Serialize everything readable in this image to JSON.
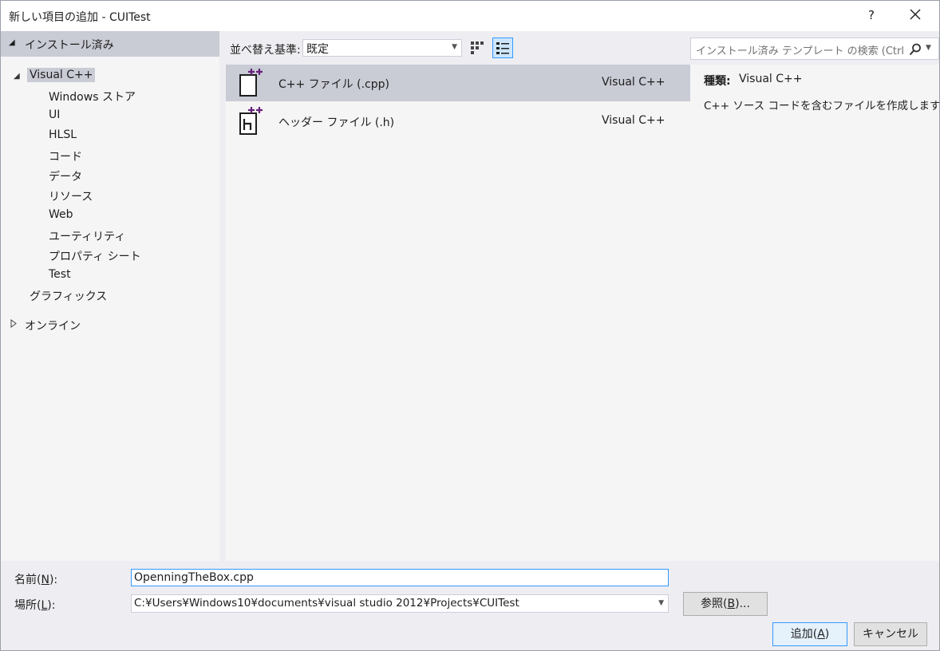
{
  "window": {
    "title": "新しい項目の追加 - CUITest",
    "help_glyph": "?",
    "close_icon": "close-icon"
  },
  "tree": {
    "installed_label": "インストール済み",
    "visual_cpp": "Visual C++",
    "children": [
      "Windows ストア",
      "UI",
      "HLSL",
      "コード",
      "データ",
      "リソース",
      "Web",
      "ユーティリティ",
      "プロパティ シート",
      "Test"
    ],
    "graphics": "グラフィックス",
    "online": "オンライン"
  },
  "toolbar": {
    "sort_label": "並べ替え基準:",
    "sort_value": "既定"
  },
  "search": {
    "placeholder": "インストール済み テンプレート の検索 (Ctrl+E)"
  },
  "templates": [
    {
      "name": "C++ ファイル (.cpp)",
      "lang": "Visual C++",
      "icon": "cpp-file-icon",
      "selected": true
    },
    {
      "name": "ヘッダー ファイル (.h)",
      "lang": "Visual C++",
      "icon": "header-file-icon",
      "selected": false
    }
  ],
  "details": {
    "type_label": "種類:",
    "type_value": "Visual C++",
    "description": "C++ ソース コードを含むファイルを作成します。"
  },
  "form": {
    "name_label_pre": "名前(",
    "name_label_key": "N",
    "name_label_post": "):",
    "name_value": "OpenningTheBox.cpp",
    "location_label_pre": "場所(",
    "location_label_key": "L",
    "location_label_post": "):",
    "location_value": "C:¥Users¥Windows10¥documents¥visual studio 2012¥Projects¥CUITest",
    "browse_pre": "参照(",
    "browse_key": "B",
    "browse_post": ")...",
    "add_pre": "追加(",
    "add_key": "A",
    "add_post": ")",
    "cancel": "キャンセル"
  },
  "colors": {
    "selection": "#c9cbd5",
    "accent": "#3399ff",
    "cpp_plus": "#68217a"
  }
}
